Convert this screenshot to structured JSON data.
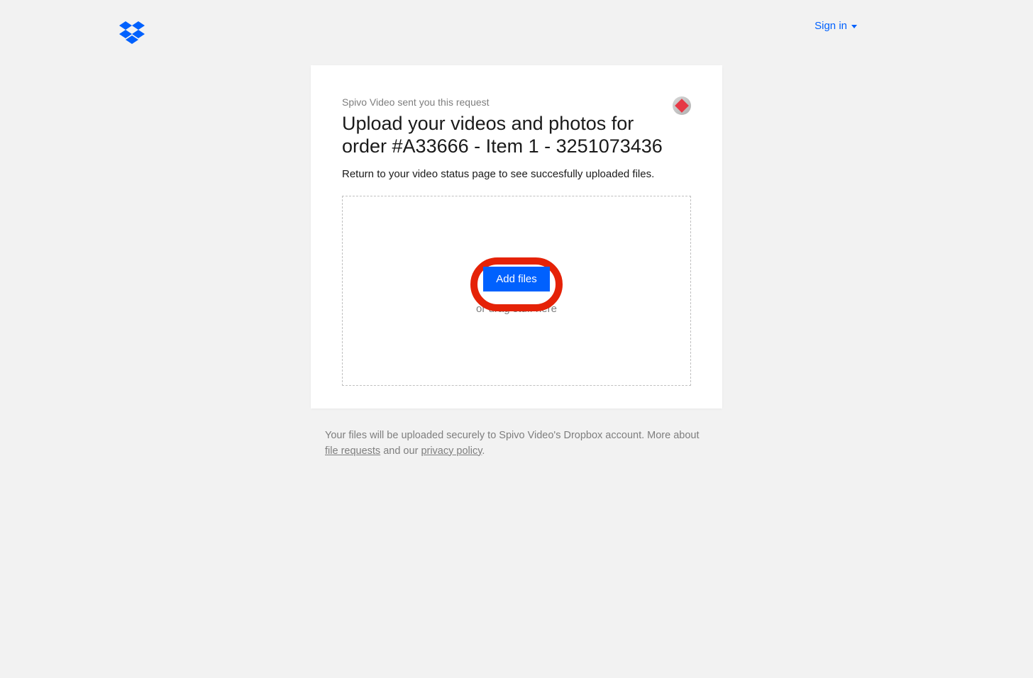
{
  "header": {
    "signin_label": "Sign in"
  },
  "card": {
    "sender_text": "Spivo Video sent you this request",
    "title": "Upload your videos and photos for order #A33666 - Item 1 - 3251073436",
    "subtitle": "Return to your video status page to see succesfully uploaded files.",
    "add_files_label": "Add files",
    "drag_text": "or drag stuff here"
  },
  "footer": {
    "prefix": "Your files will be uploaded securely to Spivo Video's Dropbox account. More about ",
    "link1": "file requests",
    "mid": " and our ",
    "link2": "privacy policy",
    "suffix": "."
  }
}
